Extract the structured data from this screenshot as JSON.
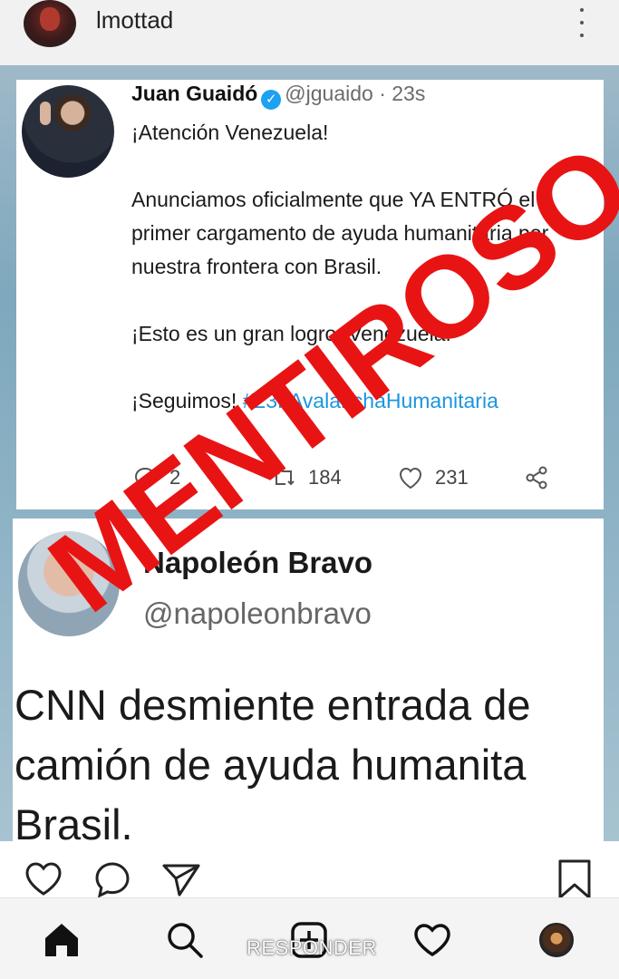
{
  "header": {
    "username": "lmottad"
  },
  "tweet_original": {
    "name": "Juan Guaidó",
    "handle": "@jguaido · 23s",
    "line1": "¡Atención Venezuela!",
    "line2": "Anunciamos oficialmente que YA ENTRÓ el primer cargamento de ayuda humanitaria por nuestra frontera con Brasil.",
    "line3": "¡Esto es un gran logro, Venezuela!",
    "line4_prefix": "¡Seguimos!",
    "hashtag": "#23FAvalanchaHumanitaria",
    "replies": "2",
    "retweets": "184",
    "likes": "231"
  },
  "stamp": {
    "text": "MENTIROSO",
    "color": "#e81414"
  },
  "tweet_reply": {
    "name": "Napoleón Bravo",
    "handle": "@napoleonbravo",
    "line1": "CNN desmiente entrada de",
    "line2": "camión de ayuda humanita",
    "line3": "Brasil."
  },
  "overlay": {
    "reply_label": "RESPONDER"
  },
  "icons": {
    "post_actions": [
      "heart-icon",
      "comment-icon",
      "send-icon",
      "bookmark-icon"
    ],
    "bottom_nav": [
      "home-icon",
      "search-icon",
      "add-post-icon",
      "activity-heart-icon",
      "profile-avatar"
    ]
  },
  "colors": {
    "hashtag": "#1b95e0",
    "verified": "#1da1f2"
  }
}
